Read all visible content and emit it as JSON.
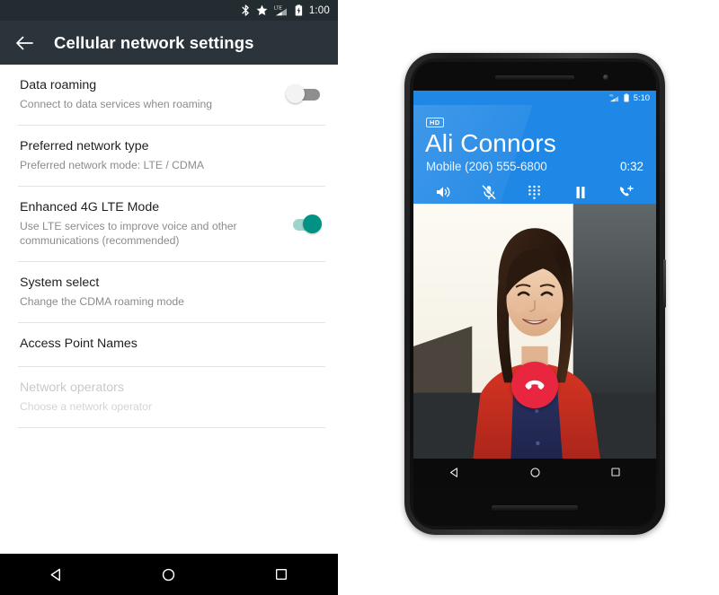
{
  "left_screenshot": {
    "status_bar": {
      "icons": [
        "bluetooth-icon",
        "star-icon",
        "lte-signal-icon",
        "battery-charging-icon"
      ],
      "clock": "1:00",
      "background": "#232c31"
    },
    "app_bar": {
      "back_icon": "back-arrow-icon",
      "title": "Cellular network settings",
      "background": "#2a343a"
    },
    "settings": [
      {
        "title": "Data roaming",
        "subtitle": "Connect to data services when roaming",
        "control": "switch",
        "switch_state": "off",
        "enabled": true
      },
      {
        "title": "Preferred network type",
        "subtitle": "Preferred network mode: LTE / CDMA",
        "control": "none",
        "enabled": true
      },
      {
        "title": "Enhanced 4G LTE Mode",
        "subtitle": "Use LTE services to improve voice and other communications (recommended)",
        "control": "switch",
        "switch_state": "on",
        "enabled": true
      },
      {
        "title": "System select",
        "subtitle": "Change the CDMA roaming mode",
        "control": "none",
        "enabled": true
      },
      {
        "title": "Access Point Names",
        "subtitle": "",
        "control": "none",
        "enabled": true
      },
      {
        "title": "Network operators",
        "subtitle": "Choose a network operator",
        "control": "none",
        "enabled": false
      }
    ],
    "nav_bar": {
      "back": "nav-back-icon",
      "home": "nav-home-icon",
      "recents": "nav-recents-icon"
    }
  },
  "phone_mockup": {
    "device": "nexus-6-phone",
    "screen": {
      "status_bar": {
        "icons": [
          "signal-icon",
          "battery-icon"
        ],
        "clock": "5:10",
        "background": "#1f87e5"
      },
      "call": {
        "hd_badge": "HD",
        "caller_name": "Ali Connors",
        "caller_number": "Mobile (206) 555-6800",
        "timer": "0:32",
        "accent": "#1f87e5",
        "actions": [
          {
            "name": "speaker-icon",
            "label": "Speaker",
            "state": "on"
          },
          {
            "name": "mic-muted-icon",
            "label": "Mute",
            "state": "muted"
          },
          {
            "name": "dialpad-icon",
            "label": "Dialpad",
            "state": "off"
          },
          {
            "name": "pause-icon",
            "label": "Hold",
            "state": "off"
          },
          {
            "name": "add-call-icon",
            "label": "Add call",
            "state": "off"
          }
        ],
        "end_call": {
          "name": "end-call-icon",
          "color": "#e8263f"
        }
      },
      "nav_bar": {
        "back": "nav-back-icon",
        "home": "nav-home-icon",
        "recents": "nav-recents-icon"
      }
    }
  }
}
